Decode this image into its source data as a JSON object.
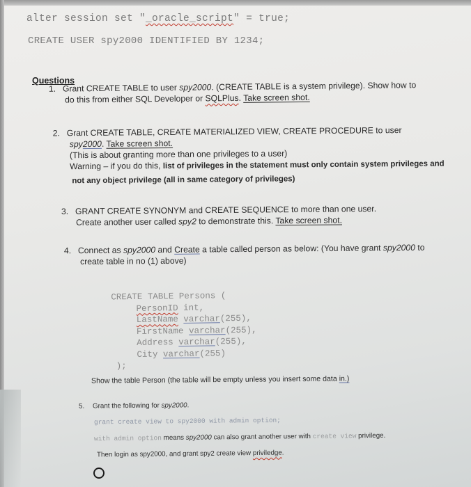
{
  "code_header": {
    "line1_prefix": "alter session set \"",
    "line1_keyword": "_oracle_script",
    "line1_suffix": "\" = true;",
    "line2": "CREATE USER spy2000 IDENTIFIED BY 1234;"
  },
  "questions_heading": "Questions",
  "q1": {
    "number": "1.",
    "line1_a": "Grant CREATE TABLE to user ",
    "line1_user": "spy2000",
    "line1_b": ". (CREATE TABLE is a system privilege). Show how to",
    "line2_a": "do this from either SQL Developer or ",
    "line2_tool": "SQLPlus",
    "line2_b": ". ",
    "line2_link": "Take screen shot."
  },
  "q2": {
    "number": "2.",
    "line1": "Grant CREATE TABLE, CREATE MATERIALIZED VIEW, CREATE PROCEDURE to user",
    "line2_user_a": "spy",
    "line2_user_b": "2000",
    "line2_sep": ".  ",
    "line2_link": "Take screen shot.",
    "line3": "(This is about granting more than one privileges to a user)",
    "line4_a": "Warning – if you do this, ",
    "line4_b": "list of privileges in the statement must only contain system privileges and",
    "line5": "not any object privilege (all in same category of privileges)"
  },
  "q3": {
    "number": "3.",
    "line1": "GRANT CREATE SYNONYM and CREATE SEQUENCE to more than one user.",
    "line2_a": "Create another user called ",
    "line2_user": "spy2",
    "line2_b": " to demonstrate this. ",
    "line2_link": "Take screen shot."
  },
  "q4": {
    "number": "4.",
    "line1_a": "Connect as ",
    "line1_user": "spy2000",
    "line1_b": " and ",
    "line1_create": "Create",
    "line1_c": " a table called person as below: (You have grant ",
    "line1_user2": "spy2000",
    "line1_d": " to",
    "line2": "create table in no (1) above)",
    "sql": {
      "open": "CREATE TABLE Persons (",
      "columns": [
        {
          "name": "PersonID",
          "type": "int",
          "sep": ","
        },
        {
          "name": "LastName",
          "type": "varchar",
          "size": "(255)",
          "sep": ","
        },
        {
          "name": "FirstName",
          "type": "varchar",
          "size": "(255)",
          "sep": ","
        },
        {
          "name": "Address",
          "type": "varchar",
          "size": "(255)",
          "sep": ","
        },
        {
          "name": "City",
          "type": "varchar",
          "size": "(255)",
          "sep": ""
        }
      ],
      "close": ");"
    },
    "show_a": "Show the table Person (the table will be empty unless you insert some data ",
    "show_link": "in.)"
  },
  "q5": {
    "number": "5.",
    "line1_a": "Grant the following for ",
    "line1_user": "spy2000",
    "line1_b": ".",
    "code": "grant create view to spy2000 with admin option;",
    "line3_code": "with admin option",
    "line3_a": " means ",
    "line3_user": "spy2000",
    "line3_b": " can also grant another user with ",
    "line3_code2": "create view",
    "line3_c": " privilege.",
    "line4_a": "Then login as spy2000, and grant spy2 create view ",
    "line4_word": "priviledge",
    "line4_b": "."
  },
  "icons": {
    "bullet": "circle-icon"
  }
}
